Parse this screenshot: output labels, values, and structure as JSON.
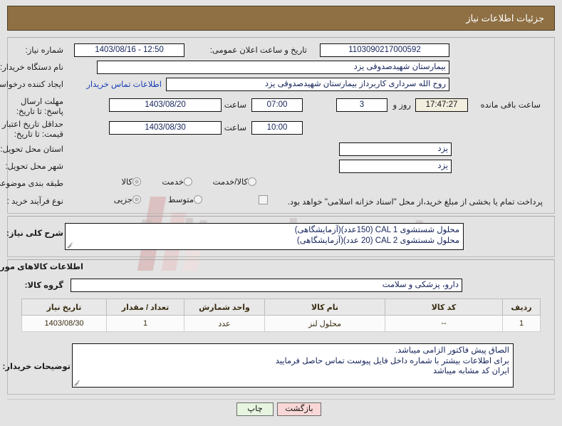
{
  "header": {
    "title": "جزئیات اطلاعات نیاز"
  },
  "watermark": {
    "text": "Aritender.net"
  },
  "form": {
    "need_number": {
      "label": "شماره نیاز:",
      "value": "1103090217000592"
    },
    "buyer_org": {
      "label": "نام دستگاه خریدار:",
      "value": "بیمارستان شهیدصدوقی یزد"
    },
    "request_creator": {
      "label": "ایجاد کننده درخواست:",
      "value": "روح الله سرداری کاربرداز بیمارستان شهیدصدوقی یزد"
    },
    "buyer_contact_link": "اطلاعات تماس خریدار",
    "announce_datetime": {
      "label": "تاریخ و ساعت اعلان عمومی:",
      "value": "1403/08/16 - 12:50"
    },
    "response_deadline": {
      "label": "مهلت ارسال پاسخ: تا تاریخ:",
      "date": "1403/08/20",
      "time_label": "ساعت",
      "time": "07:00",
      "days": "3",
      "days_label": "روز و",
      "countdown": "17:47:27",
      "countdown_label": "ساعت باقی مانده"
    },
    "price_validity": {
      "label": "حداقل تاریخ اعتبار قیمت: تا تاریخ:",
      "date": "1403/08/30",
      "time_label": "ساعت",
      "time": "10:00"
    },
    "delivery_province": {
      "label": "استان محل تحویل:",
      "value": "یزد"
    },
    "delivery_city": {
      "label": "شهر محل تحویل:",
      "value": "یزد"
    },
    "subject_class": {
      "label": "طبقه بندی موضوعی:",
      "options": [
        "کالا",
        "خدمت",
        "کالا/خدمت"
      ],
      "selected": "کالا"
    },
    "purchase_process": {
      "label": "نوع فرآیند خرید :",
      "options": [
        "جزیی",
        "متوسط"
      ],
      "selected": "جزیی"
    },
    "treasury_note": {
      "checked": false,
      "text": "پرداخت تمام یا بخشی از مبلغ خرید،از محل \"اسناد خزانه اسلامی\" خواهد بود."
    }
  },
  "need_description": {
    "label": "شرح کلی نیاز:",
    "lines": [
      "محلول شستشوی CAL 1  (150عدد)(آزمایشگاهی)",
      "محلول شستشوی CAL 2 (20 عدد)(آزمایشگاهی)"
    ]
  },
  "goods_section": {
    "title": "اطلاعات کالاهای مورد نیاز",
    "group": {
      "label": "گروه کالا:",
      "value": "دارو، پزشکی و سلامت"
    },
    "table": {
      "columns": [
        "ردیف",
        "کد کالا",
        "نام کالا",
        "واحد شمارش",
        "تعداد / مقدار",
        "تاریخ نیاز"
      ],
      "rows": [
        [
          "1",
          "--",
          "محلول لنز",
          "عدد",
          "1",
          "1403/08/30"
        ]
      ]
    },
    "buyer_notes": {
      "label": "توضیحات خریدار:",
      "lines": [
        "الصاق پیش فاکتور الزامی میباشد.",
        "برای اطلاعات بیشتر با شماره داخل فایل پیوست تماس حاصل فرمایید",
        "ایران کد مشابه میباشد"
      ]
    }
  },
  "actions": {
    "print": "چاپ",
    "back": "بازگشت"
  }
}
